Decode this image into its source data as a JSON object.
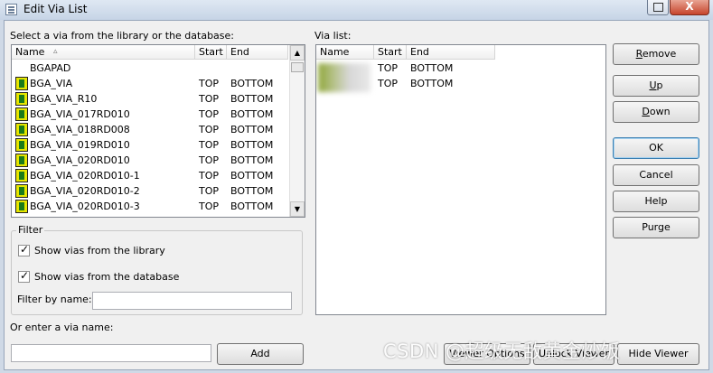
{
  "window": {
    "title": "Edit Via List",
    "close_glyph": "X"
  },
  "left": {
    "heading": "Select a via from the library or the database:",
    "columns": [
      "Name",
      "Start",
      "End"
    ],
    "rows": [
      {
        "name": "BGAPAD",
        "start": "",
        "end": "",
        "icon": false
      },
      {
        "name": "BGA_VIA",
        "start": "TOP",
        "end": "BOTTOM",
        "icon": true
      },
      {
        "name": "BGA_VIA_R10",
        "start": "TOP",
        "end": "BOTTOM",
        "icon": true
      },
      {
        "name": "BGA_VIA_017RD010",
        "start": "TOP",
        "end": "BOTTOM",
        "icon": true
      },
      {
        "name": "BGA_VIA_018RD008",
        "start": "TOP",
        "end": "BOTTOM",
        "icon": true
      },
      {
        "name": "BGA_VIA_019RD010",
        "start": "TOP",
        "end": "BOTTOM",
        "icon": true
      },
      {
        "name": "BGA_VIA_020RD010",
        "start": "TOP",
        "end": "BOTTOM",
        "icon": true
      },
      {
        "name": "BGA_VIA_020RD010-1",
        "start": "TOP",
        "end": "BOTTOM",
        "icon": true
      },
      {
        "name": "BGA_VIA_020RD010-2",
        "start": "TOP",
        "end": "BOTTOM",
        "icon": true
      },
      {
        "name": "BGA_VIA_020RD010-3",
        "start": "TOP",
        "end": "BOTTOM",
        "icon": true
      }
    ]
  },
  "right": {
    "heading": "Via list:",
    "columns": [
      "Name",
      "Start",
      "End"
    ],
    "rows": [
      {
        "start": "TOP",
        "end": "BOTTOM"
      },
      {
        "start": "TOP",
        "end": "BOTTOM"
      }
    ]
  },
  "buttons": {
    "remove": "Remove",
    "up": "Up",
    "down": "Down",
    "ok": "OK",
    "cancel": "Cancel",
    "help": "Help",
    "purge": "Purge",
    "add": "Add",
    "viewer_options": "Viewer Options",
    "unlock_viewer": "Unlock Viewer",
    "hide_viewer": "Hide Viewer"
  },
  "filter": {
    "title": "Filter",
    "show_library": "Show vias from the library",
    "show_database": "Show vias from the database",
    "show_library_checked": true,
    "show_database_checked": true,
    "filter_label": "Filter by name:",
    "filter_value": ""
  },
  "enter": {
    "label": "Or enter a via name:",
    "value": ""
  },
  "watermark": "CSDN @超级无敌黄金炒饭"
}
